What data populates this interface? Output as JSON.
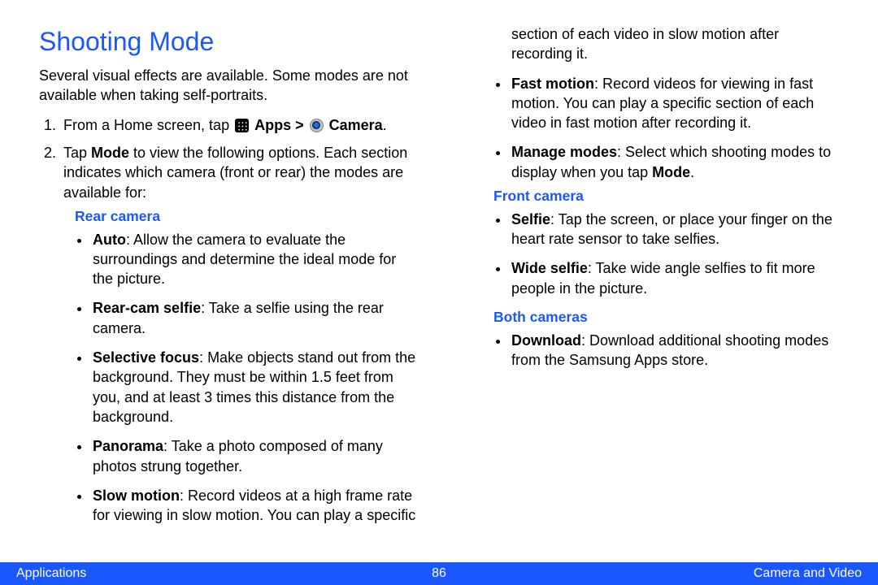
{
  "title": "Shooting Mode",
  "intro": "Several visual effects are available. Some modes are not available when taking self-portraits.",
  "step1": {
    "prefix": "From a Home screen, tap ",
    "apps_label": "Apps",
    "sep": " > ",
    "camera_label": "Camera",
    "suffix": "."
  },
  "step2": {
    "prefix": "Tap ",
    "mode_label": "Mode",
    "rest": " to view the following options. Each section indicates which camera (front or rear) the modes are available for:"
  },
  "rear": {
    "heading": "Rear camera",
    "items": [
      {
        "name": "Auto",
        "desc": ": Allow the camera to evaluate the surroundings and determine the ideal mode for the picture."
      },
      {
        "name": "Rear-cam selfie",
        "desc": ": Take a selfie using the rear camera."
      },
      {
        "name": "Selective focus",
        "desc": ": Make objects stand out from the background. They must be within 1.5 feet from you, and at least 3 times this distance from the background."
      },
      {
        "name": "Panorama",
        "desc": ": Take a photo composed of many photos strung together."
      },
      {
        "name": "Slow motion",
        "desc": ": Record videos at a high frame rate for viewing in slow motion. You can play a specific section of each video in slow motion after recording it."
      },
      {
        "name": "Fast motion",
        "desc": ": Record videos for viewing in fast motion. You can play a specific section of each video in fast motion after recording it."
      },
      {
        "name": "Manage modes",
        "desc_pre": ": Select which shooting modes to display when you tap ",
        "desc_bold": "Mode",
        "desc_post": "."
      }
    ]
  },
  "front": {
    "heading": "Front camera",
    "items": [
      {
        "name": "Selfie",
        "desc": ": Tap the screen, or place your finger on the heart rate sensor to take selfies."
      },
      {
        "name": "Wide selfie",
        "desc": ": Take wide angle selfies to fit more people in the picture."
      }
    ]
  },
  "both": {
    "heading": "Both cameras",
    "items": [
      {
        "name": "Download",
        "desc": ": Download additional shooting modes from the Samsung Apps store."
      }
    ]
  },
  "footer": {
    "left": "Applications",
    "center": "86",
    "right": "Camera and Video"
  }
}
